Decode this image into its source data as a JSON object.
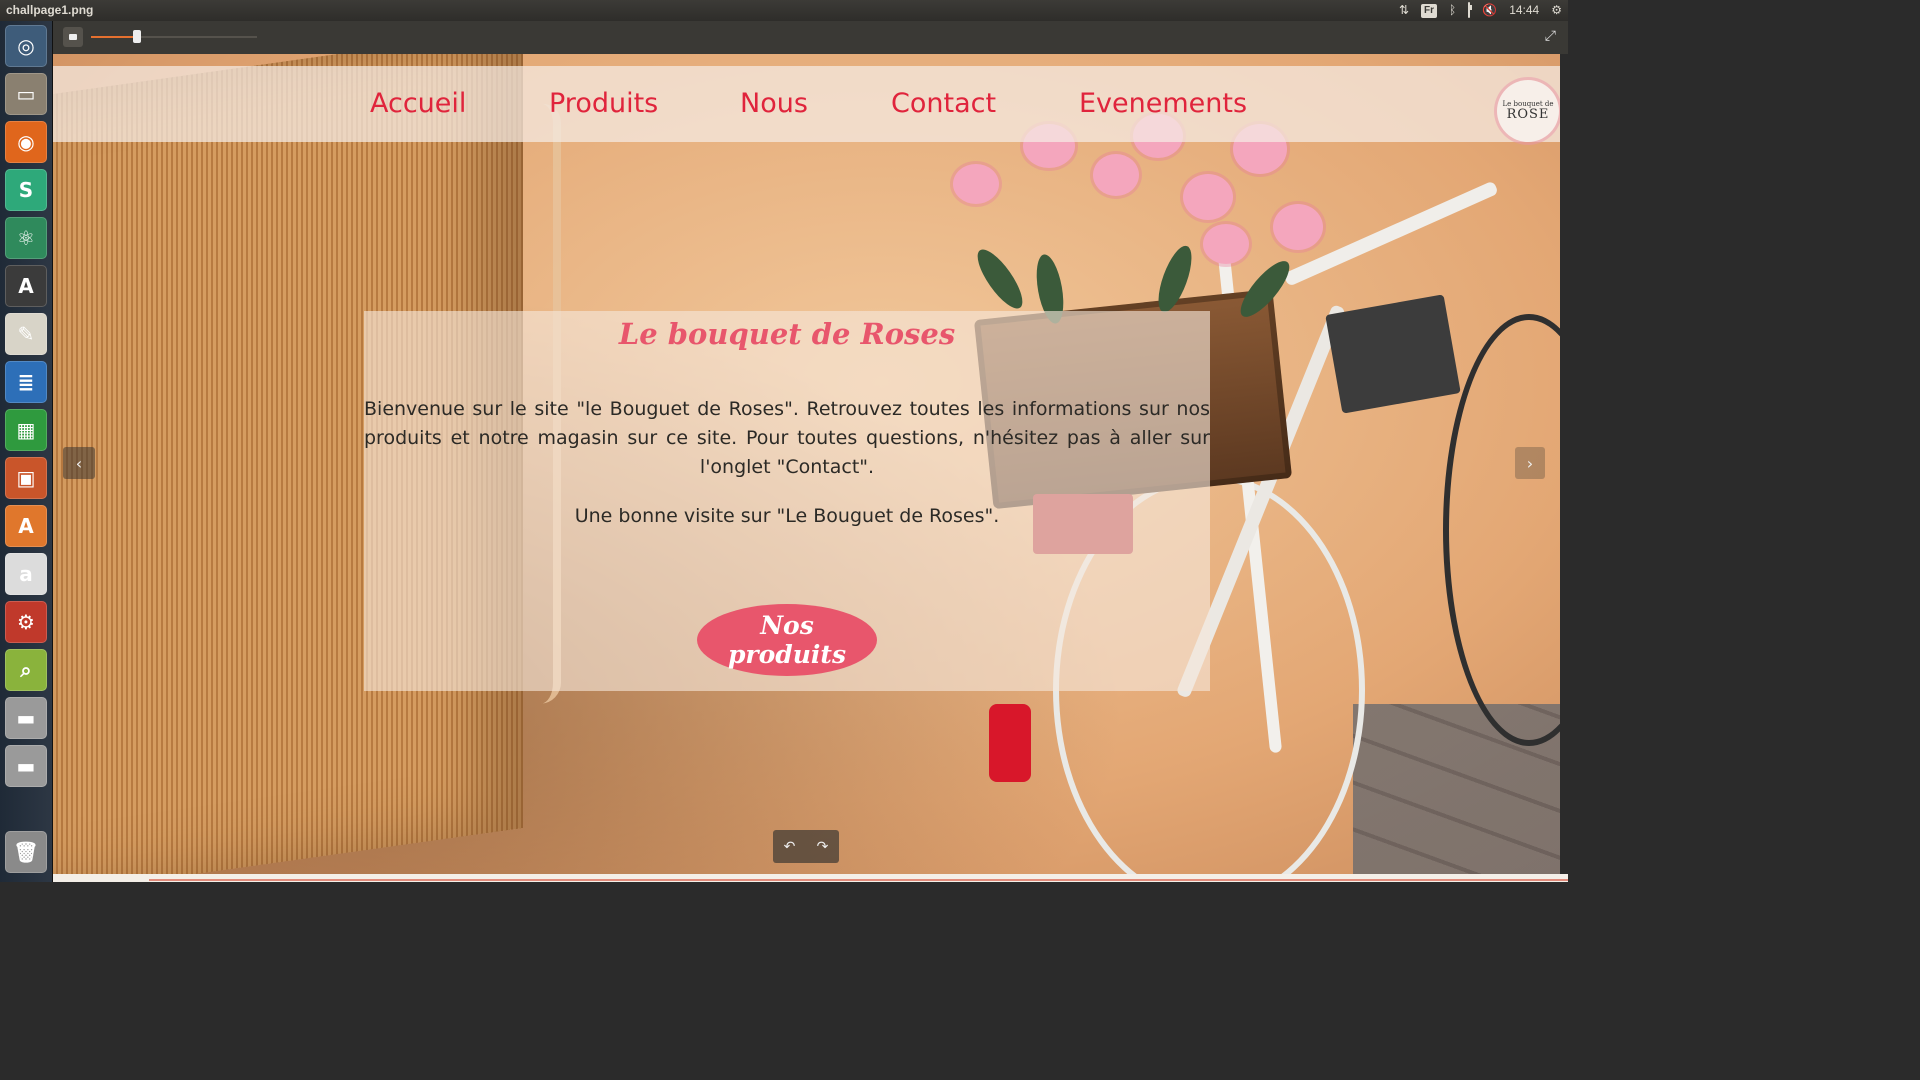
{
  "window": {
    "title": "challpage1.png"
  },
  "panel": {
    "keyboard_layout": "Fr",
    "time": "14:44",
    "icons": [
      "network-updown-icon",
      "keyboard-layout-icon",
      "bluetooth-icon",
      "battery-icon",
      "volume-muted-icon",
      "gear-icon"
    ]
  },
  "launcher": {
    "apps": [
      {
        "name": "ubuntu-dash-icon",
        "glyph": "◎",
        "color": "#3e5c7a"
      },
      {
        "name": "files-icon",
        "glyph": "▭",
        "color": "#8a8070"
      },
      {
        "name": "firefox-icon",
        "glyph": "◉",
        "color": "#e0661c"
      },
      {
        "name": "slack-icon",
        "glyph": "S",
        "color": "#2ea97a"
      },
      {
        "name": "atom-icon",
        "glyph": "⚛",
        "color": "#2f8a5c"
      },
      {
        "name": "software-updater-icon",
        "glyph": "A",
        "color": "#3b3b3b"
      },
      {
        "name": "text-editor-icon",
        "glyph": "✎",
        "color": "#d8d4c8"
      },
      {
        "name": "writer-icon",
        "glyph": "≣",
        "color": "#2d6fb8"
      },
      {
        "name": "calc-icon",
        "glyph": "▦",
        "color": "#2f9a3e"
      },
      {
        "name": "impress-icon",
        "glyph": "▣",
        "color": "#c9552a"
      },
      {
        "name": "software-center-icon",
        "glyph": "A",
        "color": "#e0772c"
      },
      {
        "name": "amazon-icon",
        "glyph": "a",
        "color": "#dcdcdc"
      },
      {
        "name": "system-settings-icon",
        "glyph": "⚙",
        "color": "#c0392b"
      },
      {
        "name": "image-viewer-icon",
        "glyph": "⌕",
        "color": "#8ab33c"
      },
      {
        "name": "drive-icon",
        "glyph": "▬",
        "color": "#9a9a9a"
      },
      {
        "name": "drive-2-icon",
        "glyph": "▬",
        "color": "#9a9a9a"
      },
      {
        "name": "trash-icon",
        "glyph": "🗑",
        "color": "#8a8a8a"
      }
    ]
  },
  "viewer": {
    "zoom_fraction": 0.28
  },
  "site": {
    "nav": [
      "Accueil",
      "Produits",
      "Nous",
      "Contact",
      "Evenements"
    ],
    "logo": {
      "line1": "Le bouquet de",
      "line2": "ROSE"
    },
    "heading": "Le bouquet de Roses",
    "paragraph1": "Bienvenue sur le site \"le Bouguet de Roses\". Retrouvez toutes les informations sur nos produits et notre magasin sur ce site. Pour toutes questions, n'hésitez pas à aller sur l'onglet \"Contact\".",
    "paragraph2": "Une bonne visite sur \"Le Bouguet de Roses\".",
    "cta": "Nos produits"
  },
  "controls": {
    "prev_glyph": "‹",
    "next_glyph": "›",
    "rotate_left_glyph": "↶",
    "rotate_right_glyph": "↷"
  }
}
